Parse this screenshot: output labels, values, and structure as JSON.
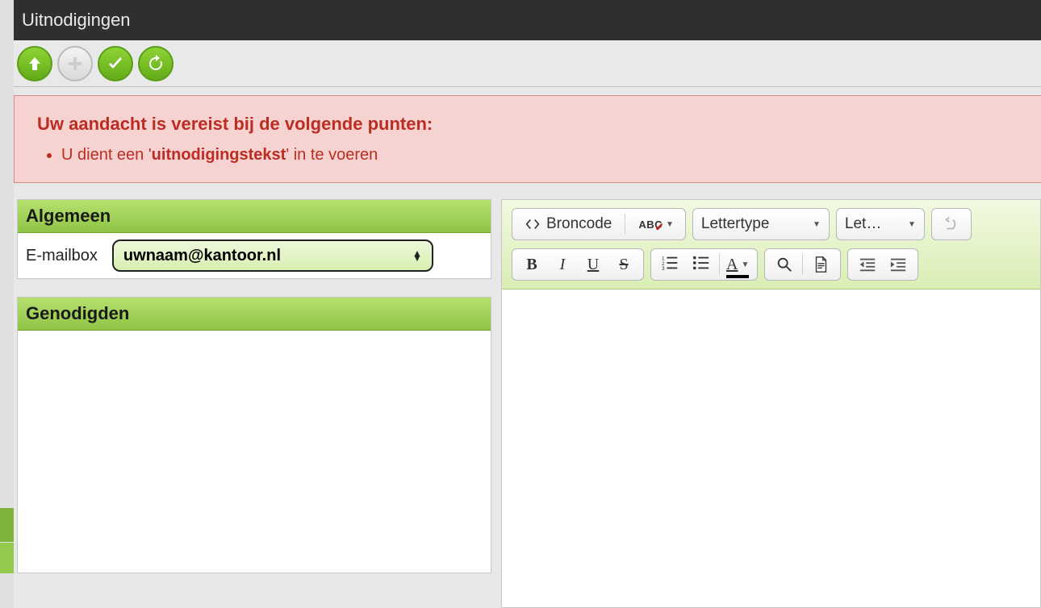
{
  "titlebar": {
    "title": "Uitnodigingen"
  },
  "toolbar": {
    "up_name": "up-button",
    "add_name": "add-button",
    "ok_name": "confirm-button",
    "refresh_name": "refresh-button"
  },
  "alert": {
    "heading": "Uw aandacht is vereist bij de volgende punten:",
    "item_prefix": "U dient een '",
    "item_bold": "uitnodigingstekst",
    "item_suffix": "' in te voeren"
  },
  "panels": {
    "algemeen": {
      "title": "Algemeen",
      "emailbox_label": "E-mailbox",
      "emailbox_value": "uwnaam@kantoor.nl"
    },
    "genodigden": {
      "title": "Genodigden"
    }
  },
  "editor": {
    "broncode_label": "Broncode",
    "lettertype_label": "Lettertype",
    "lettergrootte_label": "Let…",
    "bold": "B",
    "italic": "I",
    "underline": "U",
    "strike": "S",
    "font_color": "A",
    "abc": "ABC"
  }
}
